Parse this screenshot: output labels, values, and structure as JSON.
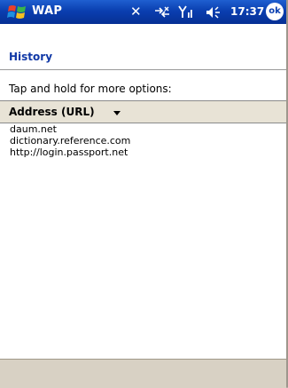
{
  "taskbar": {
    "app_title": "WAP",
    "clock": "17:37",
    "ok_label": "ok",
    "icons": [
      "start-flag-icon",
      "tools-icon",
      "connectivity-icon",
      "signal-icon",
      "speaker-icon"
    ]
  },
  "page": {
    "title": "History",
    "instructions": "Tap and hold for more options:"
  },
  "list": {
    "column_header": "Address (URL)",
    "items": [
      "daum.net",
      "dictionary.reference.com",
      "http://login.passport.net"
    ]
  },
  "colors": {
    "taskbar": "#0a3fb0",
    "title_text": "#1038a6",
    "header_bg": "#e8e3d6",
    "menubar": "#d8d1c4"
  }
}
